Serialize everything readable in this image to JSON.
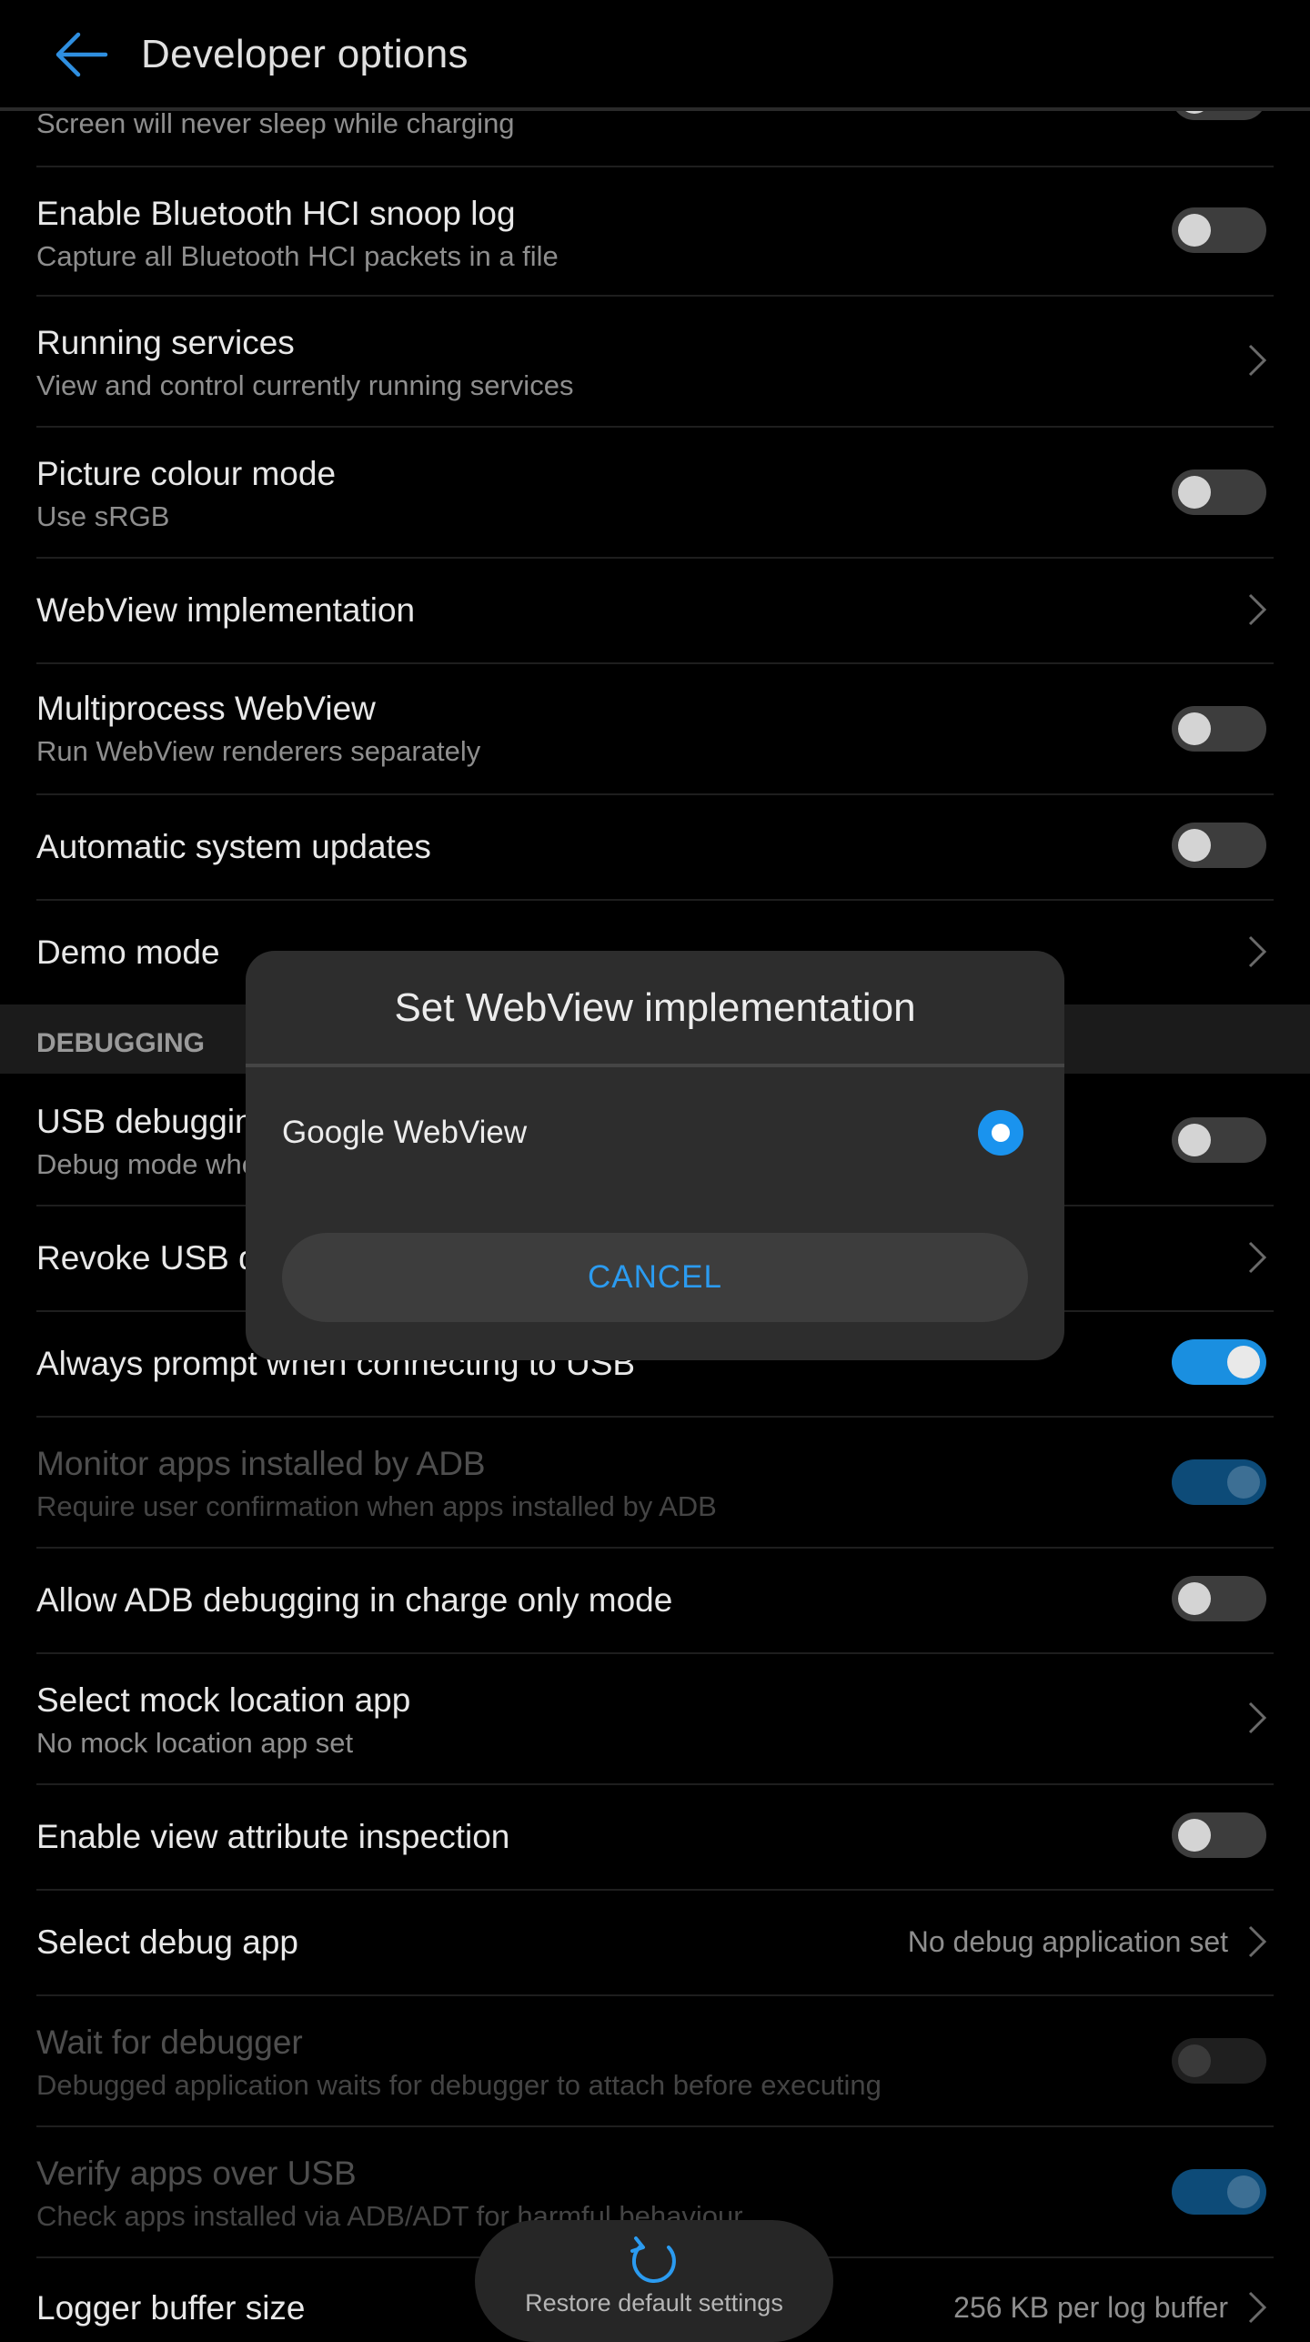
{
  "appbar": {
    "title": "Developer options"
  },
  "rows": [
    {
      "summary": "Screen will never sleep while charging"
    },
    {
      "title": "Enable Bluetooth HCI snoop log",
      "summary": "Capture all Bluetooth HCI packets in a file",
      "toggle": "off"
    },
    {
      "title": "Running services",
      "summary": "View and control currently running services"
    },
    {
      "title": "Picture colour mode",
      "summary": "Use sRGB",
      "toggle": "off"
    },
    {
      "title": "WebView implementation"
    },
    {
      "title": "Multiprocess WebView",
      "summary": "Run WebView renderers separately",
      "toggle": "off"
    },
    {
      "title": "Automatic system updates",
      "toggle": "off"
    },
    {
      "title": "Demo mode"
    }
  ],
  "section": {
    "label": "DEBUGGING"
  },
  "debug_rows": [
    {
      "title": "USB debugging",
      "summary": "Debug mode when USB is connected",
      "toggle": "off"
    },
    {
      "title": "Revoke USB debugging authorisations"
    },
    {
      "title": "Always prompt when connecting to USB",
      "toggle": "on"
    },
    {
      "title": "Monitor apps installed by ADB",
      "summary": "Require user confirmation when apps installed by ADB",
      "toggle": "on",
      "disabled": true
    },
    {
      "title": "Allow ADB debugging in charge only mode",
      "toggle": "off"
    },
    {
      "title": "Select mock location app",
      "summary": "No mock location app set"
    },
    {
      "title": "Enable view attribute inspection",
      "toggle": "off"
    },
    {
      "title": "Select debug app",
      "value": "No debug application set"
    },
    {
      "title": "Wait for debugger",
      "summary": "Debugged application waits for debugger to attach before executing",
      "toggle": "off",
      "disabled": true
    },
    {
      "title": "Verify apps over USB",
      "summary": "Check apps installed via ADB/ADT for harmful behaviour",
      "toggle": "on",
      "disabled": true
    },
    {
      "title": "Logger buffer size",
      "value": "256 KB per log buffer"
    }
  ],
  "dialog": {
    "title": "Set WebView implementation",
    "option": "Google WebView",
    "selected": true,
    "cancel_label": "CANCEL"
  },
  "restore": {
    "label": "Restore default settings",
    "icon": "refresh-icon"
  },
  "colors": {
    "accent": "#1a93ee",
    "background": "#000000",
    "dialog": "#2d2d2d"
  }
}
